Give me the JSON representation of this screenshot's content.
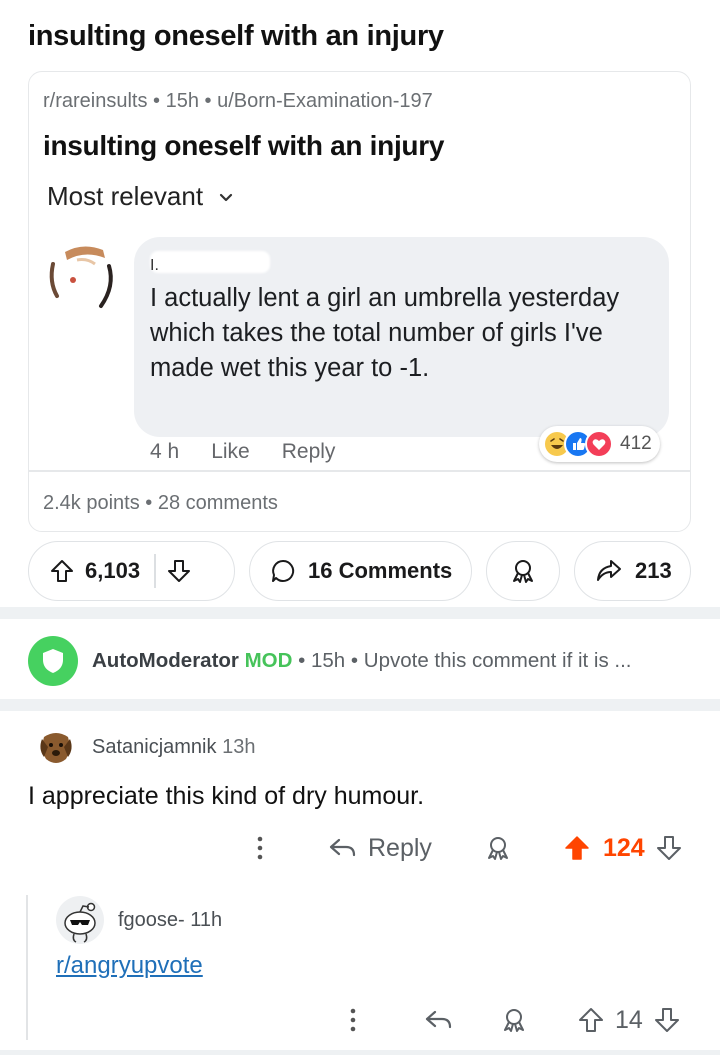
{
  "post": {
    "title": "insulting oneself with an injury"
  },
  "crosspost": {
    "meta": "r/rareinsults • 15h • u/Born-Examination-197",
    "title": "insulting oneself with an injury",
    "sort_label": "Most relevant",
    "stats": "2.4k points • 28 comments",
    "fb_comment": {
      "name_mark": "I.",
      "text": "I actually lent a girl an umbrella yesterday which takes the total number of girls I've made wet this year to -1.",
      "time": "4 h",
      "like_label": "Like",
      "reply_label": "Reply",
      "reaction_count": "412"
    }
  },
  "action_bar": {
    "upvotes": "6,103",
    "comments_label": "16 Comments",
    "shares": "213"
  },
  "automod": {
    "name": "AutoModerator",
    "badge": "MOD",
    "meta": " • 15h • Upvote this comment if it is ..."
  },
  "comment": {
    "username": "Satanicjamnik",
    "time": "13h",
    "body": "I appreciate this kind of dry humour.",
    "reply_label": "Reply",
    "votes": "124"
  },
  "reply": {
    "username": "fgoose-",
    "time": "11h",
    "link_text": "r/angryupvote",
    "votes": "14"
  },
  "colors": {
    "upvote_active": "#ff4500",
    "mod_green": "#46d160",
    "link_blue": "#1f6fb8",
    "band_gray": "#eef1f3"
  }
}
